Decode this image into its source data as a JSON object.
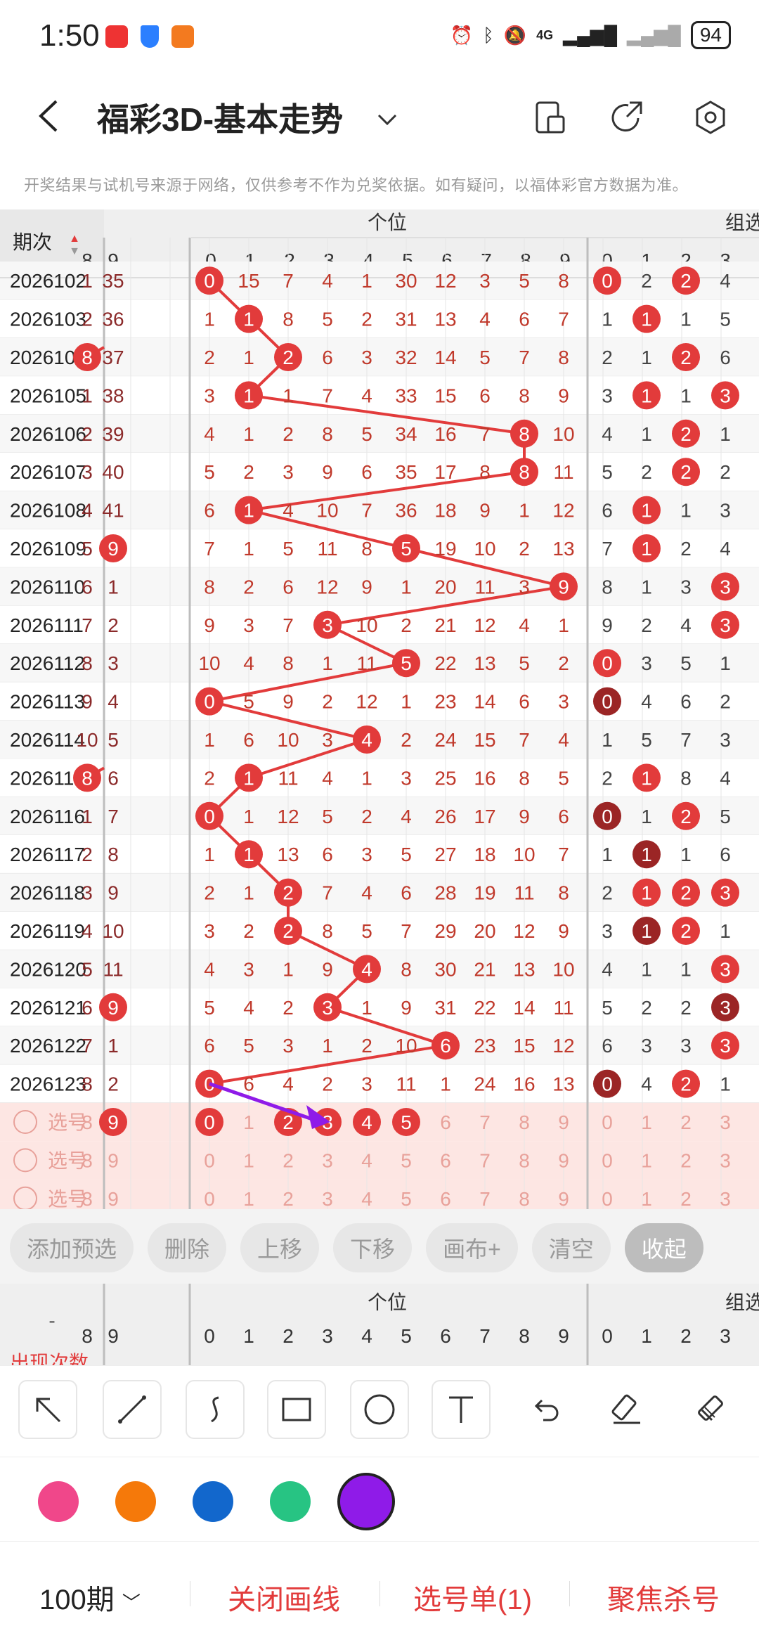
{
  "status_bar": {
    "time": "1:50",
    "network": "4G",
    "battery": "94"
  },
  "header": {
    "title": "福彩3D-基本走势"
  },
  "notice": "开奖结果与试机号来源于网络，仅供参考不作为兑奖依据。如有疑问，以福体彩官方数据为准。",
  "table": {
    "period_header": "期次",
    "group_ones": "个位",
    "group_zuxuan": "组选",
    "left_cols": [
      "8",
      "9"
    ],
    "ones_cols": [
      "0",
      "1",
      "2",
      "3",
      "4",
      "5",
      "6",
      "7",
      "8",
      "9"
    ],
    "zuxuan_cols": [
      "0",
      "1",
      "2",
      "3"
    ],
    "rows": [
      {
        "period": "2026102",
        "left": [
          "1",
          "35"
        ],
        "ones": [
          "0",
          "15",
          "7",
          "4",
          "1",
          "30",
          "12",
          "3",
          "5",
          "8"
        ],
        "zx": [
          "0",
          "2",
          "2",
          "4"
        ],
        "hit": 0,
        "zh": [
          0,
          2
        ]
      },
      {
        "period": "2026103",
        "left": [
          "2",
          "36"
        ],
        "ones": [
          "1",
          "1",
          "8",
          "5",
          "2",
          "31",
          "13",
          "4",
          "6",
          "7"
        ],
        "zx": [
          "1",
          "1",
          "1",
          "5"
        ],
        "hit": 1,
        "zh": [
          1
        ]
      },
      {
        "period": "2026104",
        "left": [
          "8",
          "37"
        ],
        "ones": [
          "2",
          "1",
          "2",
          "6",
          "3",
          "32",
          "14",
          "5",
          "7",
          "8"
        ],
        "zx": [
          "2",
          "1",
          "2",
          "6"
        ],
        "hit": 2,
        "lhit": 0,
        "zh": [
          2
        ]
      },
      {
        "period": "2026105",
        "left": [
          "1",
          "38"
        ],
        "ones": [
          "3",
          "1",
          "1",
          "7",
          "4",
          "33",
          "15",
          "6",
          "8",
          "9"
        ],
        "zx": [
          "3",
          "1",
          "1",
          "3"
        ],
        "hit": 1,
        "zh": [
          1,
          3
        ]
      },
      {
        "period": "2026106",
        "left": [
          "2",
          "39"
        ],
        "ones": [
          "4",
          "1",
          "2",
          "8",
          "5",
          "34",
          "16",
          "7",
          "8",
          "10"
        ],
        "zx": [
          "4",
          "1",
          "2",
          "1"
        ],
        "hit": 8,
        "zh": [
          2
        ]
      },
      {
        "period": "2026107",
        "left": [
          "3",
          "40"
        ],
        "ones": [
          "5",
          "2",
          "3",
          "9",
          "6",
          "35",
          "17",
          "8",
          "8",
          "11"
        ],
        "zx": [
          "5",
          "2",
          "2",
          "2"
        ],
        "hit": 8,
        "zh": [
          2
        ]
      },
      {
        "period": "2026108",
        "left": [
          "4",
          "41"
        ],
        "ones": [
          "6",
          "1",
          "4",
          "10",
          "7",
          "36",
          "18",
          "9",
          "1",
          "12"
        ],
        "zx": [
          "6",
          "1",
          "1",
          "3"
        ],
        "hit": 1,
        "zh": [
          1
        ]
      },
      {
        "period": "2026109",
        "left": [
          "5",
          "9"
        ],
        "ones": [
          "7",
          "1",
          "5",
          "11",
          "8",
          "5",
          "19",
          "10",
          "2",
          "13"
        ],
        "zx": [
          "7",
          "1",
          "2",
          "4"
        ],
        "hit": 5,
        "lhit": 1,
        "zh": [
          1
        ]
      },
      {
        "period": "2026110",
        "left": [
          "6",
          "1"
        ],
        "ones": [
          "8",
          "2",
          "6",
          "12",
          "9",
          "1",
          "20",
          "11",
          "3",
          "9"
        ],
        "zx": [
          "8",
          "1",
          "3",
          "3"
        ],
        "hit": 9,
        "zh": [
          3
        ]
      },
      {
        "period": "2026111",
        "left": [
          "7",
          "2"
        ],
        "ones": [
          "9",
          "3",
          "7",
          "3",
          "10",
          "2",
          "21",
          "12",
          "4",
          "1"
        ],
        "zx": [
          "9",
          "2",
          "4",
          "3"
        ],
        "hit": 3,
        "zh": [
          3
        ]
      },
      {
        "period": "2026112",
        "left": [
          "8",
          "3"
        ],
        "ones": [
          "10",
          "4",
          "8",
          "1",
          "11",
          "5",
          "22",
          "13",
          "5",
          "2"
        ],
        "zx": [
          "0",
          "3",
          "5",
          "1"
        ],
        "hit": 5,
        "zh": [
          0
        ]
      },
      {
        "period": "2026113",
        "left": [
          "9",
          "4"
        ],
        "ones": [
          "0",
          "5",
          "9",
          "2",
          "12",
          "1",
          "23",
          "14",
          "6",
          "3"
        ],
        "zx": [
          "0",
          "4",
          "6",
          "2"
        ],
        "hit": 0,
        "zd": [
          0
        ]
      },
      {
        "period": "2026114",
        "left": [
          "10",
          "5"
        ],
        "ones": [
          "1",
          "6",
          "10",
          "3",
          "4",
          "2",
          "24",
          "15",
          "7",
          "4"
        ],
        "zx": [
          "1",
          "5",
          "7",
          "3"
        ],
        "hit": 4,
        "zh": []
      },
      {
        "period": "2026115",
        "left": [
          "8",
          "6"
        ],
        "ones": [
          "2",
          "1",
          "11",
          "4",
          "1",
          "3",
          "25",
          "16",
          "8",
          "5"
        ],
        "zx": [
          "2",
          "1",
          "8",
          "4"
        ],
        "hit": 1,
        "lhit": 0,
        "zh": [
          1
        ]
      },
      {
        "period": "2026116",
        "left": [
          "1",
          "7"
        ],
        "ones": [
          "0",
          "1",
          "12",
          "5",
          "2",
          "4",
          "26",
          "17",
          "9",
          "6"
        ],
        "zx": [
          "0",
          "1",
          "2",
          "5"
        ],
        "hit": 0,
        "zd": [
          0
        ],
        "zh": [
          2
        ]
      },
      {
        "period": "2026117",
        "left": [
          "2",
          "8"
        ],
        "ones": [
          "1",
          "1",
          "13",
          "6",
          "3",
          "5",
          "27",
          "18",
          "10",
          "7"
        ],
        "zx": [
          "1",
          "1",
          "1",
          "6"
        ],
        "hit": 1,
        "zd": [
          1
        ]
      },
      {
        "period": "2026118",
        "left": [
          "3",
          "9"
        ],
        "ones": [
          "2",
          "1",
          "2",
          "7",
          "4",
          "6",
          "28",
          "19",
          "11",
          "8"
        ],
        "zx": [
          "2",
          "1",
          "2",
          "3"
        ],
        "hit": 2,
        "zh": [
          1,
          2,
          3
        ]
      },
      {
        "period": "2026119",
        "left": [
          "4",
          "10"
        ],
        "ones": [
          "3",
          "2",
          "2",
          "8",
          "5",
          "7",
          "29",
          "20",
          "12",
          "9"
        ],
        "zx": [
          "3",
          "1",
          "2",
          "1"
        ],
        "hit": 2,
        "zd": [
          1
        ],
        "zh": [
          2
        ]
      },
      {
        "period": "2026120",
        "left": [
          "5",
          "11"
        ],
        "ones": [
          "4",
          "3",
          "1",
          "9",
          "4",
          "8",
          "30",
          "21",
          "13",
          "10"
        ],
        "zx": [
          "4",
          "1",
          "1",
          "3"
        ],
        "hit": 4,
        "zh": [
          3
        ]
      },
      {
        "period": "2026121",
        "left": [
          "6",
          "9"
        ],
        "ones": [
          "5",
          "4",
          "2",
          "3",
          "1",
          "9",
          "31",
          "22",
          "14",
          "11"
        ],
        "zx": [
          "5",
          "2",
          "2",
          "3"
        ],
        "hit": 3,
        "lhit": 1,
        "zd": [
          3
        ]
      },
      {
        "period": "2026122",
        "left": [
          "7",
          "1"
        ],
        "ones": [
          "6",
          "5",
          "3",
          "1",
          "2",
          "10",
          "6",
          "23",
          "15",
          "12"
        ],
        "zx": [
          "6",
          "3",
          "3",
          "3"
        ],
        "hit": 6,
        "zh": [
          3
        ]
      },
      {
        "period": "2026123",
        "left": [
          "8",
          "2"
        ],
        "ones": [
          "0",
          "6",
          "4",
          "2",
          "3",
          "11",
          "1",
          "24",
          "16",
          "13"
        ],
        "zx": [
          "0",
          "4",
          "2",
          "1"
        ],
        "hit": 0,
        "zd": [
          0
        ],
        "zh": [
          2
        ]
      }
    ],
    "pick_label": "选号",
    "pick_rows": [
      {
        "left": [
          "8",
          "9"
        ],
        "ones": [
          "0",
          "1",
          "2",
          "3",
          "4",
          "5",
          "6",
          "7",
          "8",
          "9"
        ],
        "zx": [
          "0",
          "1",
          "2",
          "3"
        ],
        "sel_left": [
          1
        ],
        "sel_ones": [
          0,
          2,
          3,
          4,
          5
        ]
      },
      {
        "left": [
          "8",
          "9"
        ],
        "ones": [
          "0",
          "1",
          "2",
          "3",
          "4",
          "5",
          "6",
          "7",
          "8",
          "9"
        ],
        "zx": [
          "0",
          "1",
          "2",
          "3"
        ],
        "sel_left": [],
        "sel_ones": []
      },
      {
        "left": [
          "8",
          "9"
        ],
        "ones": [
          "0",
          "1",
          "2",
          "3",
          "4",
          "5",
          "6",
          "7",
          "8",
          "9"
        ],
        "zx": [
          "0",
          "1",
          "2",
          "3"
        ],
        "sel_left": [],
        "sel_ones": []
      }
    ],
    "stats_first_header": "-",
    "stats_row_label": "出现次数"
  },
  "toolbar": {
    "buttons": [
      "添加预选",
      "删除",
      "上移",
      "下移",
      "画布+",
      "清空",
      "收起"
    ]
  },
  "draw_tools": [
    "arrow-tool-icon",
    "line-tool-icon",
    "curve-tool-icon",
    "rectangle-tool-icon",
    "circle-tool-icon",
    "text-tool-icon",
    "undo-icon",
    "eraser-icon",
    "clear-brush-icon"
  ],
  "colors": {
    "accent": "#e23b3b",
    "dark_hit": "#9b2525",
    "palette": [
      "#f0478a",
      "#f5790a",
      "#1267cc",
      "#27c483",
      "#8f1be8"
    ],
    "selected_color": "#8f1be8"
  },
  "bottom_bar": {
    "period_selector": "100期",
    "close_lines": "关闭画线",
    "selection_list": "选号单(1)",
    "focus_kill": "聚焦杀号"
  }
}
